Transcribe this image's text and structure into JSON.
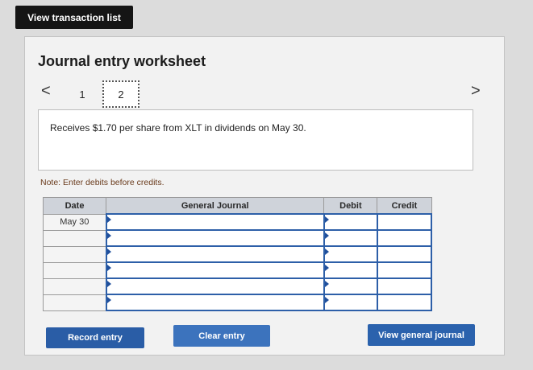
{
  "top_button": {
    "label": "View transaction list"
  },
  "worksheet": {
    "title": "Journal entry worksheet",
    "tabs": [
      {
        "label": "1"
      },
      {
        "label": "2"
      }
    ],
    "prev_symbol": "<",
    "next_symbol": ">",
    "description": "Receives $1.70 per share from XLT in dividends on May 30.",
    "note": "Note: Enter debits before credits."
  },
  "journal": {
    "headers": {
      "date": "Date",
      "general_journal": "General Journal",
      "debit": "Debit",
      "credit": "Credit"
    },
    "rows": [
      {
        "date": "May 30",
        "account": "",
        "debit": "",
        "credit": ""
      },
      {
        "date": "",
        "account": "",
        "debit": "",
        "credit": ""
      },
      {
        "date": "",
        "account": "",
        "debit": "",
        "credit": ""
      },
      {
        "date": "",
        "account": "",
        "debit": "",
        "credit": ""
      },
      {
        "date": "",
        "account": "",
        "debit": "",
        "credit": ""
      },
      {
        "date": "",
        "account": "",
        "debit": "",
        "credit": ""
      }
    ]
  },
  "buttons": {
    "record": "Record entry",
    "clear": "Clear entry",
    "view_general": "View general journal"
  }
}
